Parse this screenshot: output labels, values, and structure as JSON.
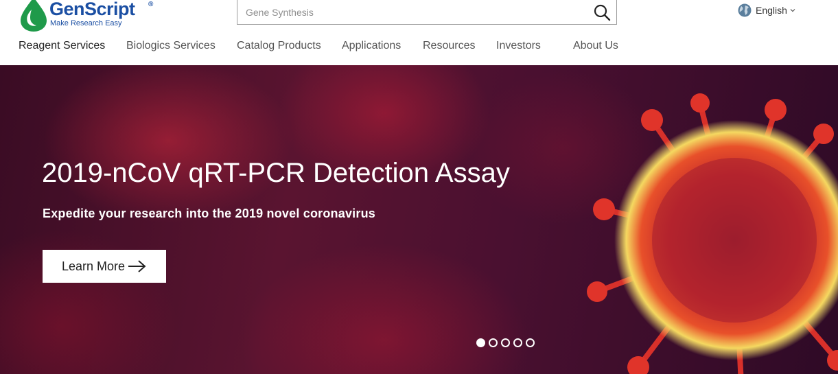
{
  "brand": {
    "name": "GenScript",
    "registered_mark": "®",
    "tagline": "Make Research Easy",
    "logo_color": "#1b4fa3",
    "logo_mark_color": "#1f9a4a"
  },
  "search": {
    "placeholder": "Gene Synthesis",
    "icon": "search-icon"
  },
  "language": {
    "label": "English",
    "icon": "globe-icon"
  },
  "nav": {
    "items": [
      {
        "label": "Reagent Services",
        "active": true
      },
      {
        "label": "Biologics Services"
      },
      {
        "label": "Catalog Products"
      },
      {
        "label": "Applications"
      },
      {
        "label": "Resources"
      },
      {
        "label": "Investors"
      },
      {
        "label": "About Us"
      }
    ]
  },
  "hero": {
    "title": "2019-nCoV qRT-PCR Detection Assay",
    "subtitle": "Expedite your research into the 2019 novel coronavirus",
    "cta_label": "Learn More",
    "cta_icon": "arrow-right-icon",
    "slides_total": 5,
    "active_slide": 1
  }
}
